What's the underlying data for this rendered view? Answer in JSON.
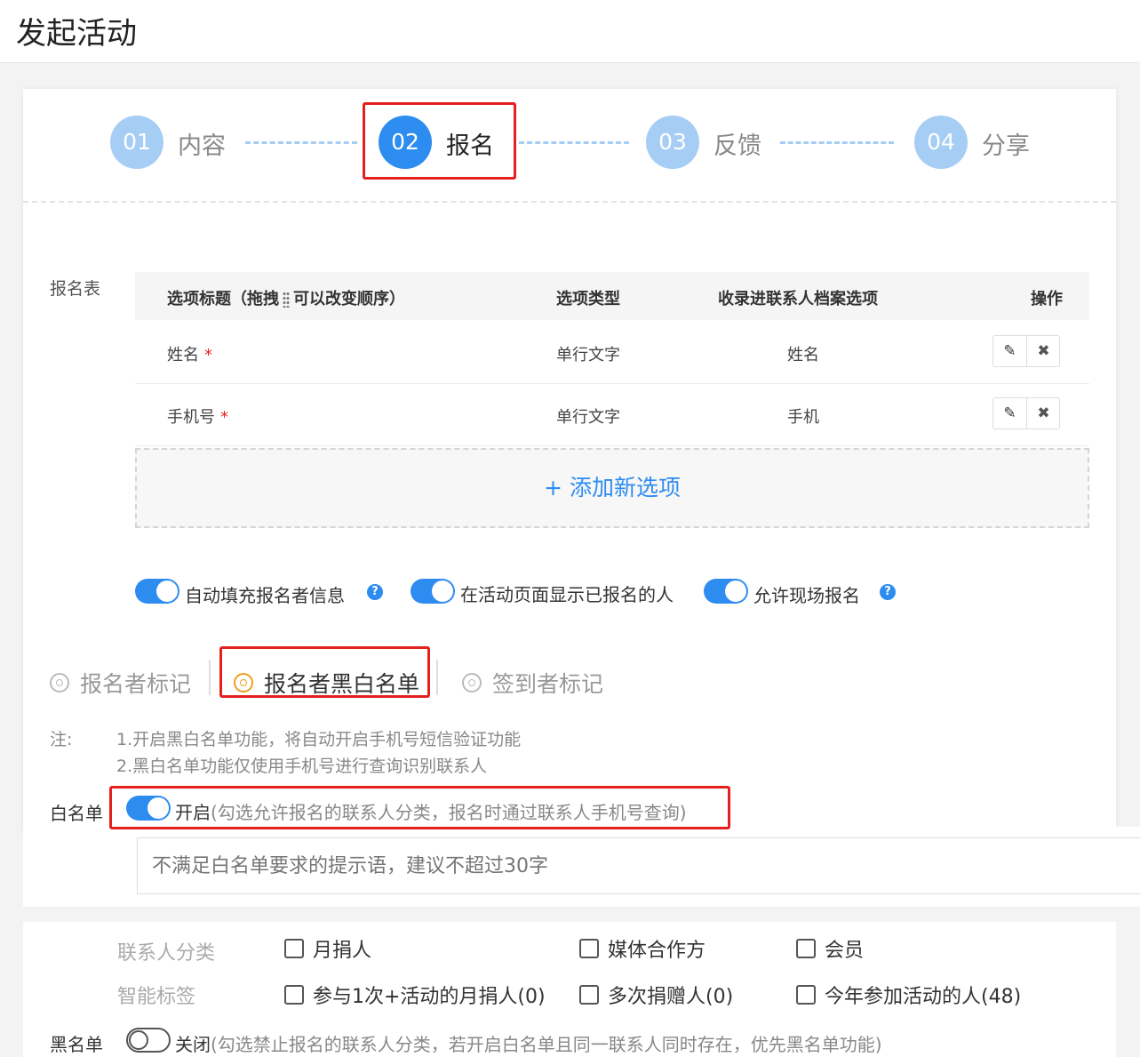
{
  "page": {
    "title": "发起活动"
  },
  "steps": [
    {
      "num": "01",
      "label": "内容"
    },
    {
      "num": "02",
      "label": "报名"
    },
    {
      "num": "03",
      "label": "反馈"
    },
    {
      "num": "04",
      "label": "分享"
    }
  ],
  "form": {
    "section_label": "报名表",
    "columns": [
      "选项标题（拖拽",
      "可以改变顺序）",
      "选项类型",
      "收录进联系人档案选项",
      "操作"
    ],
    "rows": [
      {
        "title": "姓名",
        "required": "*",
        "type": "单行文字",
        "archive": "姓名"
      },
      {
        "title": "手机号",
        "required": "*",
        "type": "单行文字",
        "archive": "手机"
      }
    ],
    "add_label": "+ 添加新选项"
  },
  "toggles": [
    {
      "label": "自动填充报名者信息",
      "on": true,
      "help": "?"
    },
    {
      "label": "在活动页面显示已报名的人",
      "on": true
    },
    {
      "label": "允许现场报名",
      "on": true,
      "help": "?"
    }
  ],
  "tabs": [
    {
      "label": "报名者标记"
    },
    {
      "label": "报名者黑白名单",
      "selected": true
    },
    {
      "label": "签到者标记"
    }
  ],
  "notes": {
    "prefix": "注:",
    "line1": "1.开启黑白名单功能，将自动开启手机号短信验证功能",
    "line2": "2.黑白名单功能仅使用手机号进行查询识别联系人"
  },
  "whitelist": {
    "label": "白名单",
    "status": "开启",
    "hint": "(勾选允许报名的联系人分类，报名时通过联系人手机号查询)",
    "input_placeholder": "不满足白名单要求的提示语，建议不超过30字"
  },
  "categories": {
    "contact_label": "联系人分类",
    "contact_items": [
      "月捐人",
      "媒体合作方",
      "会员"
    ],
    "tag_label": "智能标签",
    "tag_items": [
      "参与1次+活动的月捐人(0)",
      "多次捐赠人(0)",
      "今年参加活动的人(48)"
    ]
  },
  "blacklist": {
    "label": "黑名单",
    "status": "关闭",
    "hint": "(勾选禁止报名的联系人分类，若开启白名单且同一联系人同时存在，优先黑名单功能)"
  },
  "colors": {
    "primary": "#2d8cf0",
    "step_inactive": "#a6cdf4",
    "highlight": "#e4201e",
    "radio_active": "#f0a020"
  }
}
